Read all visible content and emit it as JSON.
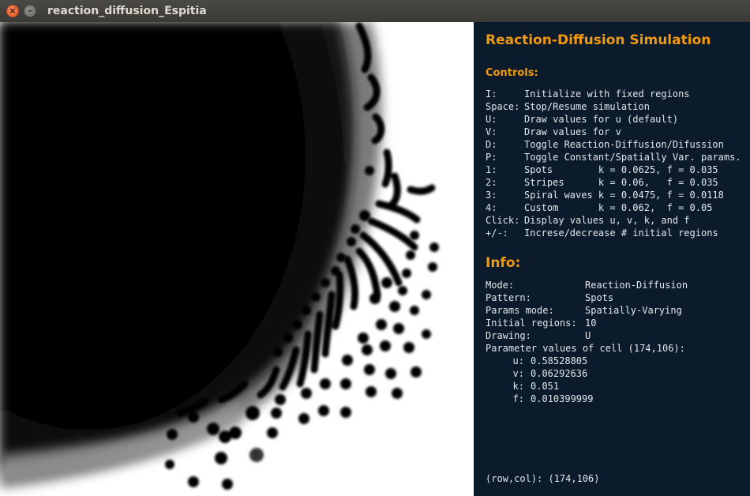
{
  "window": {
    "title": "reaction_diffusion_Espitia"
  },
  "panel": {
    "title": "Reaction-Diffusion Simulation",
    "controls_heading": "Controls:",
    "controls": [
      {
        "key": "I:",
        "desc": "Initialize with fixed regions"
      },
      {
        "key": "Space:",
        "desc": "Stop/Resume simulation"
      },
      {
        "key": "U:",
        "desc": "Draw values for u (default)"
      },
      {
        "key": "V:",
        "desc": "Draw values for v"
      },
      {
        "key": "D:",
        "desc": "Toggle Reaction-Diffusion/Difussion"
      },
      {
        "key": "P:",
        "desc": "Toggle Constant/Spatially Var. params."
      },
      {
        "key": "1:",
        "desc": "Spots        k = 0.0625, f = 0.035"
      },
      {
        "key": "2:",
        "desc": "Stripes      k = 0.06,   f = 0.035"
      },
      {
        "key": "3:",
        "desc": "Spiral waves k = 0.0475, f = 0.0118"
      },
      {
        "key": "4:",
        "desc": "Custom       k = 0.062,  f = 0.05"
      },
      {
        "key": "Click:",
        "desc": "Display values u, v, k, and f"
      },
      {
        "key": "+/-:",
        "desc": "Increse/decrease # initial regions"
      }
    ],
    "info_heading": "Info:",
    "info": [
      {
        "key": "Mode:",
        "value": "Reaction-Diffusion"
      },
      {
        "key": "Pattern:",
        "value": "Spots"
      },
      {
        "key": "Params mode:",
        "value": "Spatially-Varying"
      },
      {
        "key": "Initial regions:",
        "value": "10"
      },
      {
        "key": "Drawing:",
        "value": "U"
      }
    ],
    "param_heading": "Parameter values of cell (174,106):",
    "params": [
      {
        "key": "u:",
        "value": "0.58528805"
      },
      {
        "key": "v:",
        "value": "0.06292636"
      },
      {
        "key": "k:",
        "value": "0.051"
      },
      {
        "key": "f:",
        "value": "0.010399999"
      }
    ],
    "footer": "(row,col): (174,106)"
  },
  "colors": {
    "panel_bg": "#0b1b2c",
    "heading": "#f29a0f",
    "text": "#e3e6ea",
    "close_button": "#e2541c"
  }
}
